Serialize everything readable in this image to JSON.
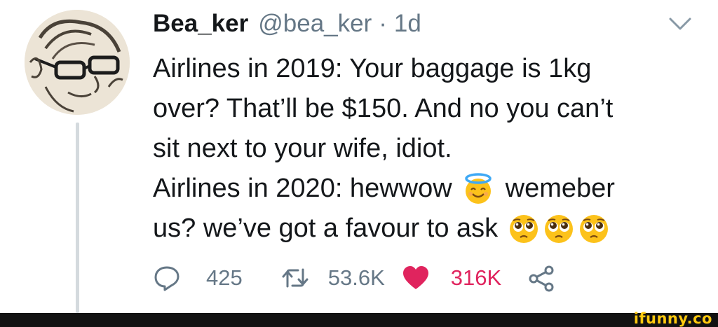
{
  "tweet": {
    "display_name": "Bea_ker",
    "handle": "@bea_ker",
    "separator": "·",
    "time": "1d",
    "lines": [
      "Airlines in 2019: Your baggage is 1kg",
      "over? That’ll be $150. And no you can’t",
      "sit next to your wife, idiot.",
      "Airlines in 2020: hewwow",
      "wemeber",
      "us? we’ve got a favour to ask"
    ],
    "emojis": {
      "halo": "smiling-face-with-halo",
      "pleading": "pleading-face"
    }
  },
  "actions": {
    "replies": "425",
    "retweets": "53.6K",
    "likes": "316K"
  },
  "colors": {
    "text": "#14171a",
    "secondary": "#657786",
    "like": "#e0245e",
    "thread_line": "#d4dade",
    "watermark": "#ffc90e"
  },
  "watermark": "ifunny.co"
}
